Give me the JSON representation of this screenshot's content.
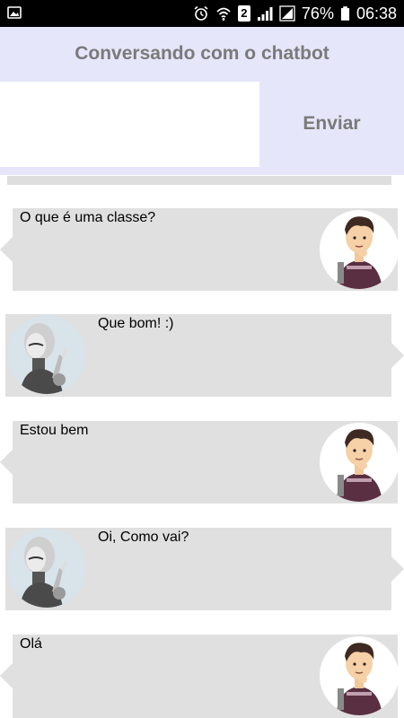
{
  "status_bar": {
    "battery": "76%",
    "time": "06:38",
    "sim_badge": "2"
  },
  "header": {
    "title": "Conversando com o chatbot"
  },
  "composer": {
    "value": "",
    "placeholder": "",
    "send_label": "Enviar"
  },
  "messages": [
    {
      "sender": "user",
      "text": "O que é uma classe?"
    },
    {
      "sender": "bot",
      "text": "Que bom! :)"
    },
    {
      "sender": "user",
      "text": "Estou bem"
    },
    {
      "sender": "bot",
      "text": "Oi, Como vai?"
    },
    {
      "sender": "user",
      "text": "Olá"
    }
  ],
  "colors": {
    "accent": "#e6e6fa",
    "bubble": "#e0e0e0",
    "title_text": "#7a7a7a"
  },
  "icons": {
    "user_avatar": "user-avatar-icon",
    "bot_avatar": "robot-avatar-icon"
  }
}
